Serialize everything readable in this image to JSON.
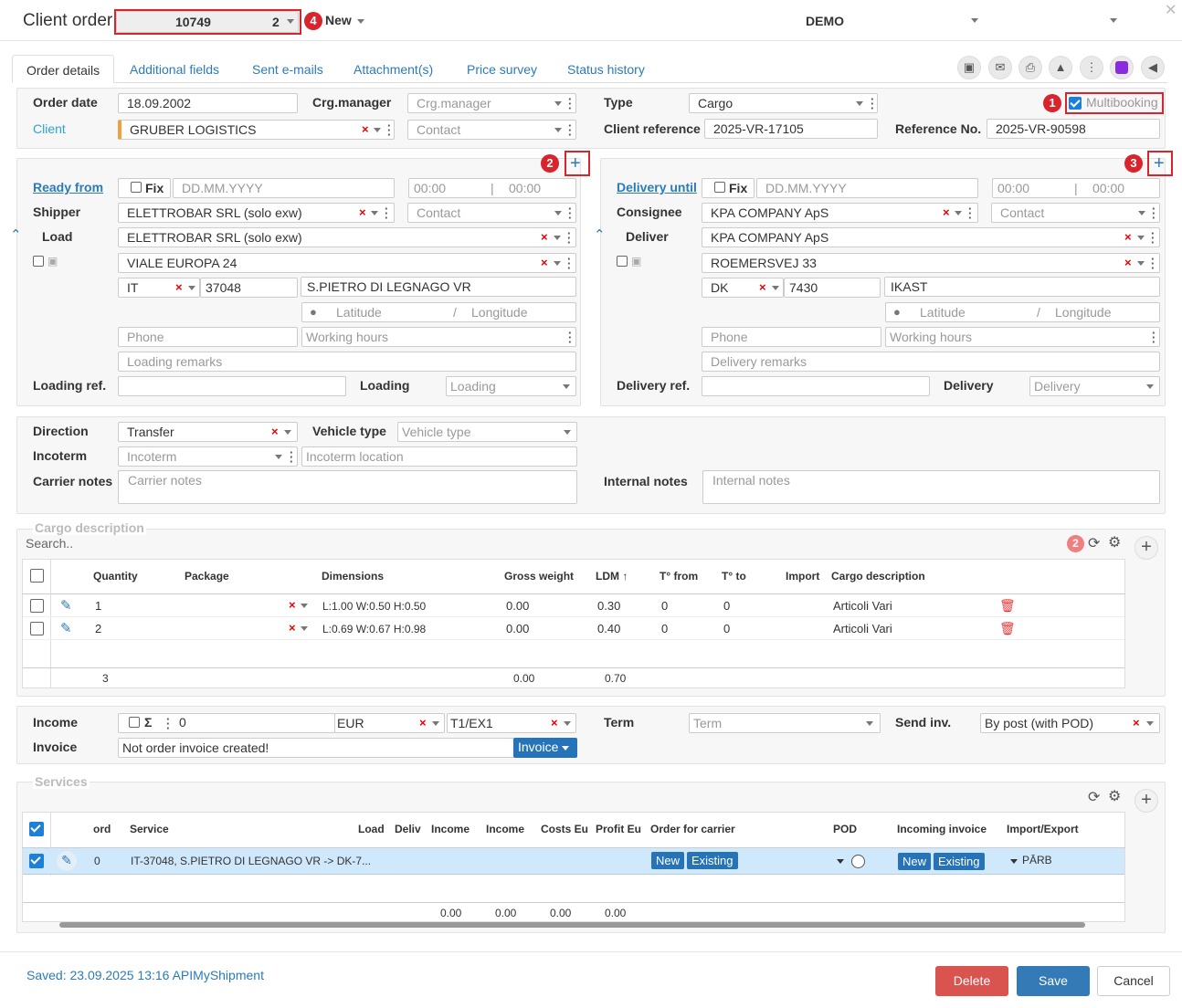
{
  "header": {
    "title": "Client order",
    "order_no": "10749",
    "order_sub": "2",
    "new_label": "New",
    "company": "DEMO"
  },
  "tabs": [
    "Order details",
    "Additional fields",
    "Sent e-mails",
    "Attachment(s)",
    "Price survey",
    "Status history"
  ],
  "toolbar_icons": [
    "save-icon",
    "email-icon",
    "print-icon",
    "road-icon",
    "more-icon",
    "ai-icon",
    "megaphone-icon"
  ],
  "annotations": [
    "1",
    "2",
    "3",
    "4"
  ],
  "order": {
    "order_date_label": "Order date",
    "order_date": "18.09.2002",
    "crg_label": "Crg.manager",
    "crg_ph": "Crg.manager",
    "type_label": "Type",
    "type": "Cargo",
    "multibooking": "Multibooking",
    "client_label": "Client",
    "client": "GRUBER LOGISTICS",
    "contact_ph": "Contact",
    "client_ref_label": "Client reference",
    "client_ref": "2025-VR-17105",
    "ref_no_label": "Reference No.",
    "ref_no": "2025-VR-90598"
  },
  "loading": {
    "ready_label": "Ready from",
    "fix": "Fix",
    "date_ph": "DD.MM.YYYY",
    "time_ph": "00:00",
    "time_sep": "|",
    "shipper_label": "Shipper",
    "shipper": "ELETTROBAR SRL (solo exw)",
    "contact_ph": "Contact",
    "load_label": "Load",
    "load": "ELETTROBAR SRL (solo exw)",
    "address": "VIALE EUROPA 24",
    "country": "IT",
    "zip": "37048",
    "city": "S.PIETRO DI LEGNAGO  VR",
    "lat_ph": "Latitude",
    "lon_ph": "Longitude",
    "slash": "/",
    "phone_ph": "Phone",
    "hours_ph": "Working hours",
    "remarks_ph": "Loading remarks",
    "ref_label": "Loading ref.",
    "type_label": "Loading",
    "type_ph": "Loading"
  },
  "delivery": {
    "until_label": "Delivery until",
    "fix": "Fix",
    "date_ph": "DD.MM.YYYY",
    "time_ph": "00:00",
    "time_sep": "|",
    "consignee_label": "Consignee",
    "consignee": "KPA COMPANY ApS",
    "contact_ph": "Contact",
    "deliver_label": "Deliver",
    "deliver": "KPA COMPANY ApS",
    "address": "ROEMERSVEJ 33",
    "country": "DK",
    "zip": "7430",
    "city": "IKAST",
    "lat_ph": "Latitude",
    "lon_ph": "Longitude",
    "slash": "/",
    "phone_ph": "Phone",
    "hours_ph": "Working hours",
    "remarks_ph": "Delivery remarks",
    "ref_label": "Delivery ref.",
    "type_label": "Delivery",
    "type_ph": "Delivery"
  },
  "transport": {
    "direction_label": "Direction",
    "direction": "Transfer",
    "vehicle_label": "Vehicle type",
    "vehicle_ph": "Vehicle type",
    "incoterm_label": "Incoterm",
    "incoterm_ph": "Incoterm",
    "incoterm_loc_ph": "Incoterm location",
    "carrier_label": "Carrier notes",
    "carrier_ph": "Carrier notes",
    "internal_label": "Internal notes",
    "internal_ph": "Internal notes"
  },
  "cargo": {
    "section": "Cargo description",
    "search_ph": "Search..",
    "count": "2",
    "headers": [
      "Quantity",
      "Package",
      "Dimensions",
      "Gross weight",
      "LDM",
      "T° from",
      "T° to",
      "Import",
      "Cargo description"
    ],
    "rows": [
      {
        "qty": "1",
        "dims": "L:1.00 W:0.50 H:0.50",
        "weight": "0.00",
        "ldm": "0.30",
        "tfrom": "0",
        "tto": "0",
        "desc": "Articoli Vari"
      },
      {
        "qty": "2",
        "dims": "L:0.69 W:0.67 H:0.98",
        "weight": "0.00",
        "ldm": "0.40",
        "tfrom": "0",
        "tto": "0",
        "desc": "Articoli Vari"
      }
    ],
    "totals": {
      "qty": "3",
      "weight": "0.00",
      "ldm": "0.70"
    }
  },
  "finance": {
    "income_label": "Income",
    "sigma": "Σ",
    "income": "0",
    "currency": "EUR",
    "customs": "T1/EX1",
    "term_label": "Term",
    "term_ph": "Term",
    "send_label": "Send inv.",
    "send": "By post (with POD)",
    "invoice_label": "Invoice",
    "invoice_text": "Not order invoice created!",
    "invoice_btn": "Invoice"
  },
  "services": {
    "section": "Services",
    "headers": [
      "ord",
      "Service",
      "Load",
      "Deliv",
      "Income",
      "Income E",
      "Costs Eu",
      "Profit Eu",
      "Order for carrier",
      "POD",
      "Incoming invoice",
      "Import/Export"
    ],
    "row": {
      "ord": "0",
      "service": "IT-37048, S.PIETRO DI LEGNAGO VR -> DK-7...",
      "new": "New",
      "existing": "Existing",
      "import_export": "PĀRB"
    },
    "totals": [
      "0.00",
      "0.00",
      "0.00",
      "0.00"
    ]
  },
  "footer": {
    "saved": "Saved: 23.09.2025 13:16 APIMyShipment",
    "delete": "Delete",
    "save": "Save",
    "cancel": "Cancel"
  },
  "colors": {
    "accent": "#2b7bb9",
    "danger": "#d9534f",
    "primary": "#337ab7",
    "highlight": "#cfe8fb"
  }
}
